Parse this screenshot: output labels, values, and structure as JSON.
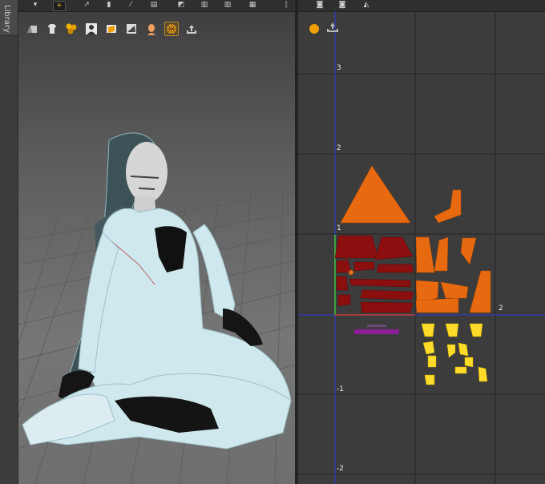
{
  "sidebar": {
    "tab_label": "Library"
  },
  "viewport": {
    "toolbar": [
      "cursor-icon",
      "move-icon",
      "rotate-icon",
      "scale-icon",
      "brush-icon",
      "grid-icon",
      "select-icon",
      "layout-icon",
      "grid2-icon"
    ],
    "icons": [
      "garment-icon",
      "shirt-icon",
      "texture-icon",
      "avatar-icon",
      "fold-icon",
      "flatten-icon",
      "head-icon",
      "mesh-icon",
      "export-icon"
    ]
  },
  "uv_editor": {
    "toolbar": [
      "camera-icon",
      "camera-icon",
      "cloth-icon"
    ],
    "axis_labels": [
      "3",
      "2",
      "1",
      "2",
      "-1",
      "-2"
    ],
    "colors": {
      "front_pieces": "#e86a10",
      "back_pieces": "#8c0f0f",
      "accent": "#ffdc2a",
      "trim": "#8a1e96",
      "axis_blue": "#2a3ad6",
      "axis_green": "#40c040",
      "grid": "#2a2a2a"
    }
  }
}
